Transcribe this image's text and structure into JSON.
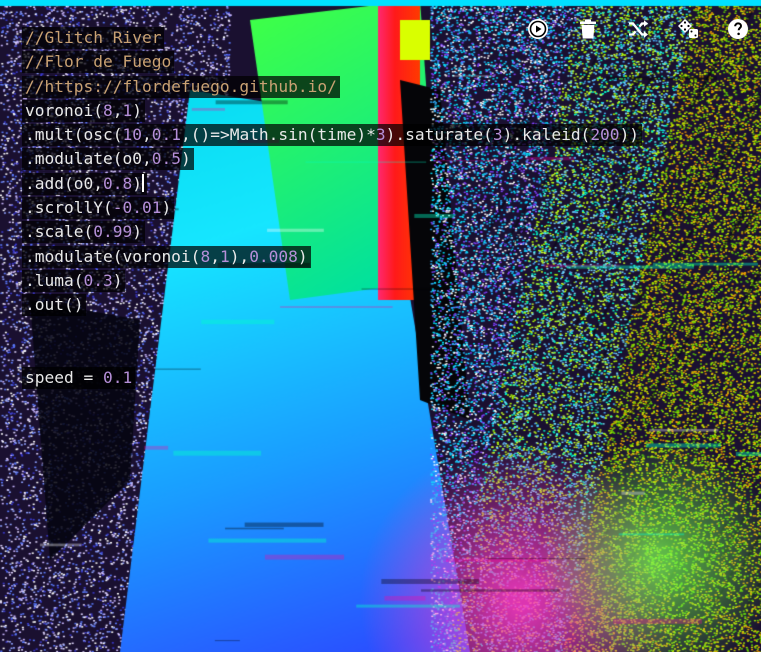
{
  "toolbar": {
    "buttons": [
      {
        "name": "run",
        "icon": "play-circle-icon"
      },
      {
        "name": "clear",
        "icon": "trash-icon"
      },
      {
        "name": "shuffle",
        "icon": "shuffle-icon"
      },
      {
        "name": "randomize",
        "icon": "dice-icon"
      },
      {
        "name": "help",
        "icon": "help-circle-icon"
      }
    ]
  },
  "editor": {
    "lines": [
      [
        {
          "t": "//Glitch River",
          "c": "comment"
        }
      ],
      [
        {
          "t": "//Flor de Fuego",
          "c": "comment"
        }
      ],
      [
        {
          "t": "//https://flordefuego.github.io/",
          "c": "comment"
        }
      ],
      [
        {
          "t": "voronoi(",
          "c": "plain"
        },
        {
          "t": "8",
          "c": "num"
        },
        {
          "t": ",",
          "c": "plain"
        },
        {
          "t": "1",
          "c": "num"
        },
        {
          "t": ")",
          "c": "plain"
        }
      ],
      [
        {
          "t": ".mult(osc(",
          "c": "plain"
        },
        {
          "t": "10",
          "c": "num"
        },
        {
          "t": ",",
          "c": "plain"
        },
        {
          "t": "0.1",
          "c": "num"
        },
        {
          "t": ",()=>Math.sin(time)*",
          "c": "plain"
        },
        {
          "t": "3",
          "c": "num"
        },
        {
          "t": ").saturate(",
          "c": "plain"
        },
        {
          "t": "3",
          "c": "num"
        },
        {
          "t": ").kaleid(",
          "c": "plain"
        },
        {
          "t": "200",
          "c": "num"
        },
        {
          "t": "))",
          "c": "plain"
        }
      ],
      [
        {
          "t": ".modulate(o0,",
          "c": "plain"
        },
        {
          "t": "0.5",
          "c": "num"
        },
        {
          "t": ")",
          "c": "plain"
        }
      ],
      [
        {
          "t": ".add(o0,",
          "c": "plain"
        },
        {
          "t": "0.8",
          "c": "num"
        },
        {
          "t": ")",
          "c": "plain"
        }
      ],
      [
        {
          "t": ".scrollY(",
          "c": "plain"
        },
        {
          "t": "-0.01",
          "c": "num"
        },
        {
          "t": ")",
          "c": "plain"
        }
      ],
      [
        {
          "t": ".scale(",
          "c": "plain"
        },
        {
          "t": "0.99",
          "c": "num"
        },
        {
          "t": ")",
          "c": "plain"
        }
      ],
      [
        {
          "t": ".modulate(voronoi(",
          "c": "plain"
        },
        {
          "t": "8",
          "c": "num"
        },
        {
          "t": ",",
          "c": "plain"
        },
        {
          "t": "1",
          "c": "num"
        },
        {
          "t": "),",
          "c": "plain"
        },
        {
          "t": "0.008",
          "c": "num"
        },
        {
          "t": ")",
          "c": "plain"
        }
      ],
      [
        {
          "t": ".luma(",
          "c": "plain"
        },
        {
          "t": "0.3",
          "c": "num"
        },
        {
          "t": ")",
          "c": "plain"
        }
      ],
      [
        {
          "t": ".out()",
          "c": "plain"
        }
      ],
      [],
      [],
      [
        {
          "t": "speed = ",
          "c": "plain"
        },
        {
          "t": "0.1",
          "c": "num"
        }
      ]
    ],
    "cursor_line": 6
  },
  "colors": {
    "comment": "#c9a173",
    "plain": "#e9e9e9",
    "number": "#b58fd8",
    "icon": "#ffffff"
  }
}
